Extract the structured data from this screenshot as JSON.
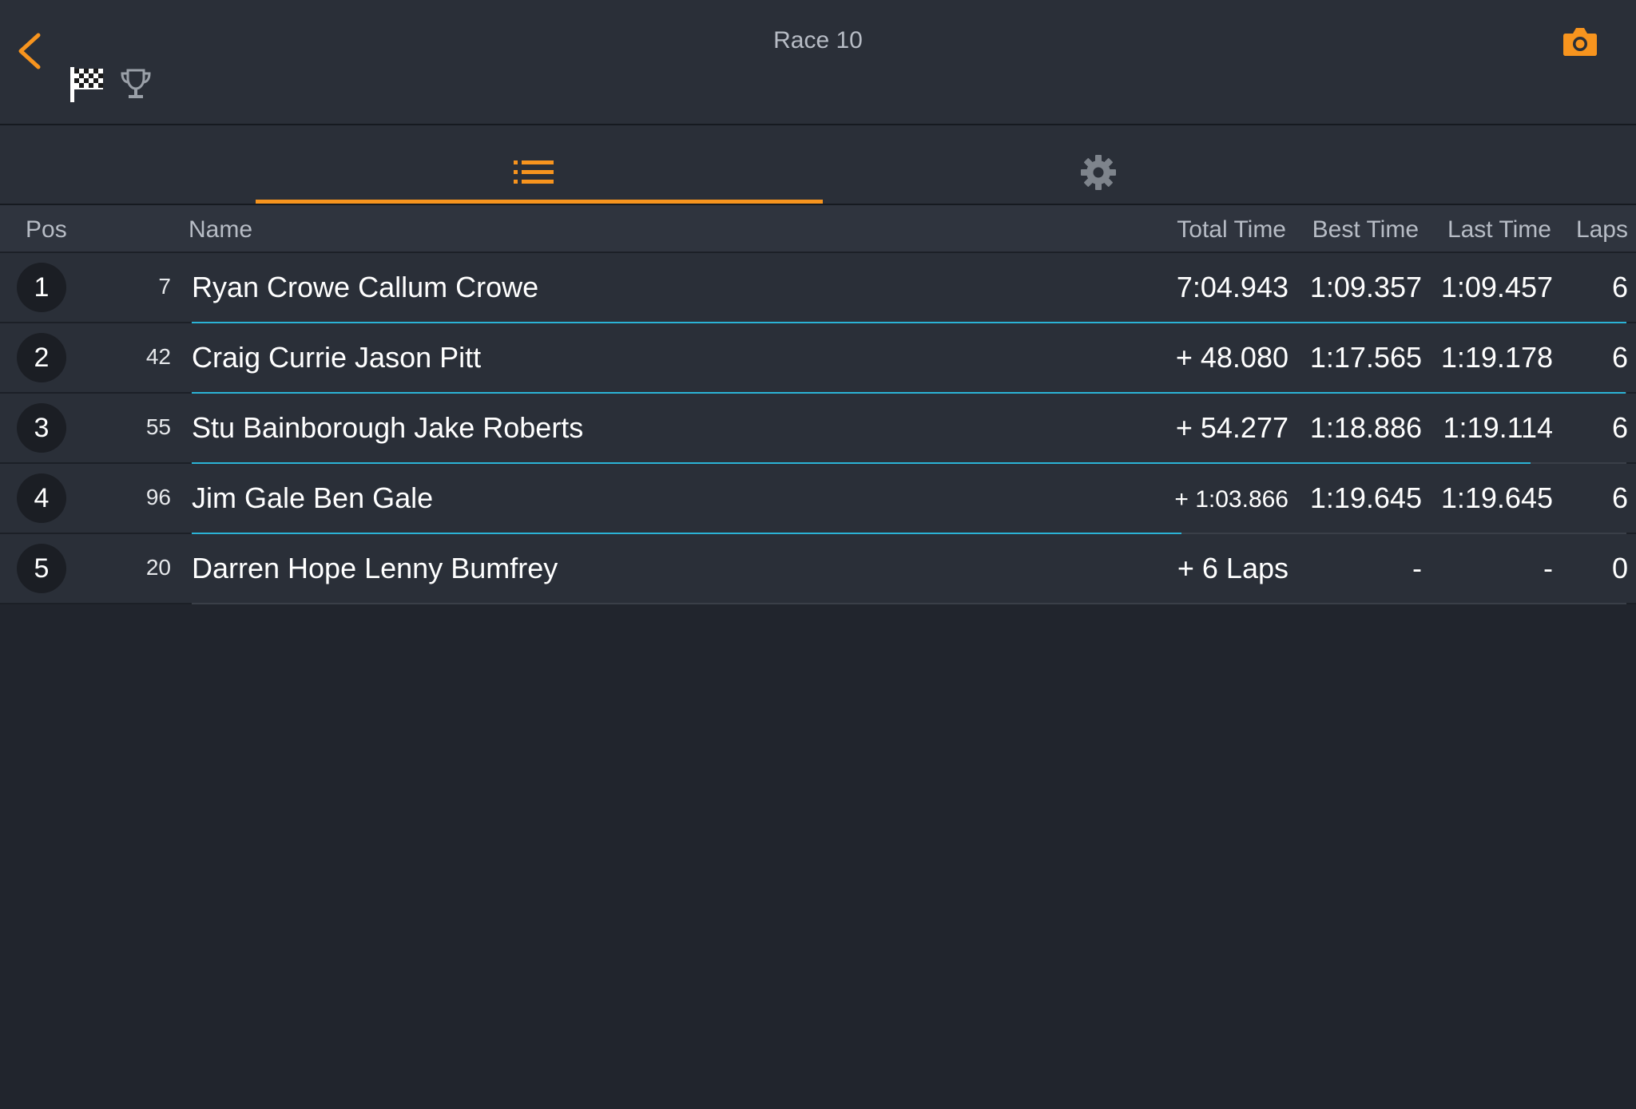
{
  "header": {
    "title": "Race 10",
    "icons": {
      "back": "chevron-left-icon",
      "flag": "checkered-flag-icon",
      "trophy": "trophy-icon",
      "camera": "camera-icon"
    },
    "accent_color": "#f7941e"
  },
  "tabs": [
    {
      "icon": "list-icon",
      "active": true
    },
    {
      "icon": "gear-icon",
      "active": false
    }
  ],
  "columns": {
    "pos": "Pos",
    "name": "Name",
    "total": "Total Time",
    "best": "Best Time",
    "last": "Last Time",
    "laps": "Laps"
  },
  "results": [
    {
      "pos": "1",
      "number": "7",
      "name": "Ryan Crowe Callum Crowe",
      "total": "7:04.943",
      "best": "1:09.357",
      "last": "1:09.457",
      "laps": "6",
      "progress": 1.0
    },
    {
      "pos": "2",
      "number": "42",
      "name": "Craig Currie Jason Pitt",
      "total": "+ 48.080",
      "best": "1:17.565",
      "last": "1:19.178",
      "laps": "6",
      "progress": 0.9995
    },
    {
      "pos": "3",
      "number": "55",
      "name": "Stu Bainborough Jake Roberts",
      "total": "+ 54.277",
      "best": "1:18.886",
      "last": "1:19.114",
      "laps": "6",
      "progress": 0.933
    },
    {
      "pos": "4",
      "number": "96",
      "name": "Jim Gale Ben Gale",
      "total": "+ 1:03.866",
      "best": "1:19.645",
      "last": "1:19.645",
      "laps": "6",
      "progress": 0.69
    },
    {
      "pos": "5",
      "number": "20",
      "name": "Darren Hope Lenny Bumfrey",
      "total": "+ 6 Laps",
      "best": "-",
      "last": "-",
      "laps": "0",
      "progress": 0.0
    }
  ],
  "progress_color": "#2bb3d6"
}
